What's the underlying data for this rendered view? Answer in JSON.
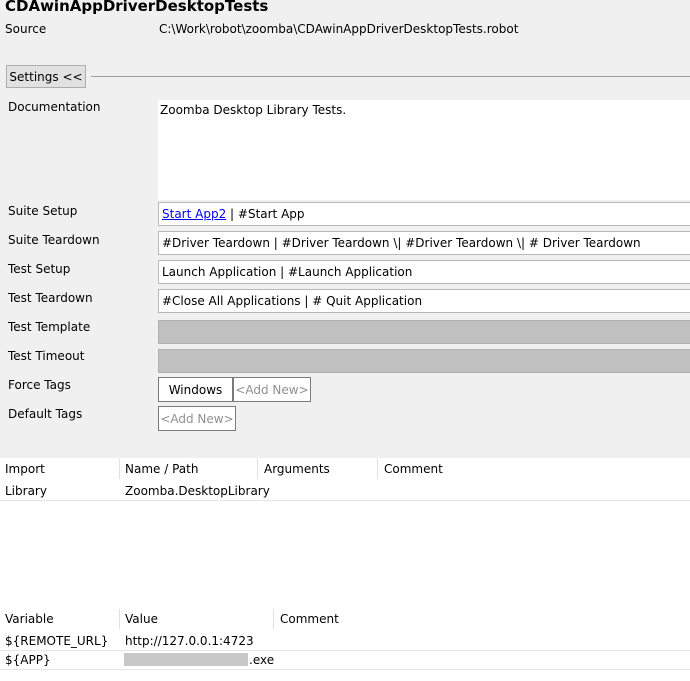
{
  "title": "CDAwinAppDriverDesktopTests",
  "source": {
    "label": "Source",
    "value": "C:\\Work\\robot\\zoomba\\CDAwinAppDriverDesktopTests.robot"
  },
  "settings_button": "Settings <<",
  "fields": {
    "documentation": {
      "label": "Documentation",
      "value": "Zoomba Desktop Library Tests."
    },
    "suite_setup": {
      "label": "Suite Setup",
      "link": "Start App2",
      "rest": " | #Start App"
    },
    "suite_teardown": {
      "label": "Suite Teardown",
      "value": "#Driver Teardown | #Driver Teardown \\| #Driver Teardown \\| # Driver Teardown"
    },
    "test_setup": {
      "label": "Test Setup",
      "value": "Launch Application | #Launch Application"
    },
    "test_teardown": {
      "label": "Test Teardown",
      "value": "#Close All Applications | # Quit Application"
    },
    "test_template": {
      "label": "Test Template"
    },
    "test_timeout": {
      "label": "Test Timeout"
    },
    "force_tags": {
      "label": "Force Tags",
      "tags": [
        "Windows"
      ],
      "add_new": "<Add New>"
    },
    "default_tags": {
      "label": "Default Tags",
      "add_new": "<Add New>"
    }
  },
  "imports": {
    "headers": [
      "Import",
      "Name / Path",
      "Arguments",
      "Comment"
    ],
    "rows": [
      {
        "type": "Library",
        "name": "Zoomba.DesktopLibrary",
        "args": "",
        "comment": ""
      }
    ]
  },
  "variables": {
    "headers": [
      "Variable",
      "Value",
      "Comment"
    ],
    "rows": [
      {
        "name": "${REMOTE_URL}",
        "value": "http://127.0.0.1:4723",
        "comment": ""
      },
      {
        "name": "${APP}",
        "value": ".exe",
        "comment": ""
      }
    ]
  }
}
